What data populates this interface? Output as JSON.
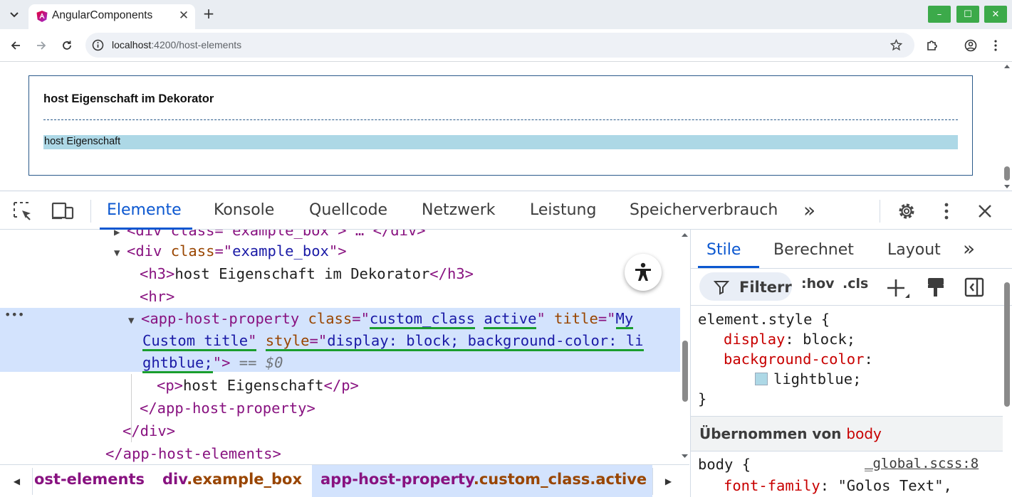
{
  "browser": {
    "tab_title": "AngularComponents",
    "url_host": "localhost",
    "url_rest": ":4200/host-elements",
    "window_controls": {
      "minimize": "–",
      "maximize": "☐",
      "close": "✕"
    }
  },
  "page": {
    "heading": "host Eigenschaft im Dekorator",
    "host_property_text": "host Eigenschaft",
    "host_background": "#add8e6"
  },
  "devtools": {
    "tabs": [
      "Elemente",
      "Konsole",
      "Quellcode",
      "Netzwerk",
      "Leistung",
      "Speicherverbrauch"
    ],
    "more_tabs": "»",
    "dom": {
      "partial_line": "<div class=\"example_box\"> … </div>",
      "div_open_tag": "div",
      "div_class_attr": "class",
      "div_class_val": "example_box",
      "h3_text": "host Eigenschaft im Dekorator",
      "hr": "<hr>",
      "app_tag": "app-host-property",
      "class_attr": "class",
      "class_val_1": "custom_class",
      "class_val_2": "active",
      "title_attr": "title",
      "title_val_1": "My",
      "title_val_2": "Custom title",
      "style_attr": "style",
      "style_val_1": "display: block; background-color: li",
      "style_val_2": "ghtblue;",
      "dollar_ref": "== $0",
      "p_text": "host Eigenschaft",
      "close_app": "</app-host-property>",
      "close_div": "</div>",
      "close_elements": "</app-host-elements>",
      "more_dots": "•••"
    },
    "breadcrumb": [
      {
        "tag": "ost-elements",
        "cls": ""
      },
      {
        "tag": "div",
        "cls": ".example_box"
      },
      {
        "tag": "app-host-property",
        "cls": ".custom_class.active"
      }
    ],
    "styles": {
      "tabs": [
        "Stile",
        "Berechnet",
        "Layout"
      ],
      "more": "»",
      "filter": "Filterr",
      "hov": ":hov",
      "cls": ".cls",
      "element_style_selector": "element.style {",
      "prop1_name": "display",
      "prop1_value": "block;",
      "prop2_name": "background-color",
      "prop2_value": "lightblue;",
      "close_brace": "}",
      "inherited_label": "Übernommen von",
      "inherited_ref": "body",
      "body_selector": "body {",
      "source_link": "_global.scss:8",
      "prop3_name": "font-family",
      "prop3_value": "\"Golos Text\","
    }
  }
}
